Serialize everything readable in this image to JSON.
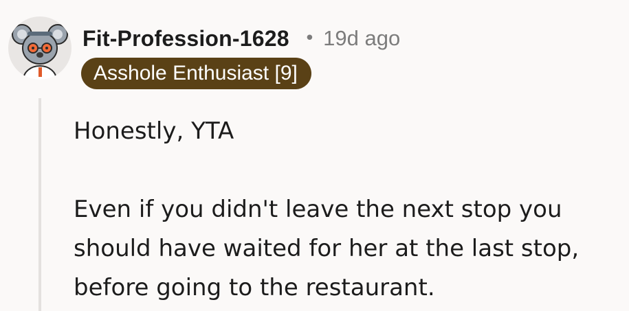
{
  "comment": {
    "author": "Fit-Profession-1628",
    "separator": "•",
    "timestamp": "19d ago",
    "flair": "Asshole Enthusiast [9]",
    "paragraphs": [
      "Honestly, YTA",
      "Even if you didn't leave the next stop you should have waited for her at the last stop, before going to the restaurant."
    ]
  },
  "avatar": {
    "icon": "koala-snoo-avatar-icon"
  },
  "colors": {
    "background": "#fbf9f8",
    "flair_background": "#5a4116",
    "flair_text": "#ffffff",
    "muted_text": "#7c7c7c",
    "thread_line": "#e4e1df"
  }
}
